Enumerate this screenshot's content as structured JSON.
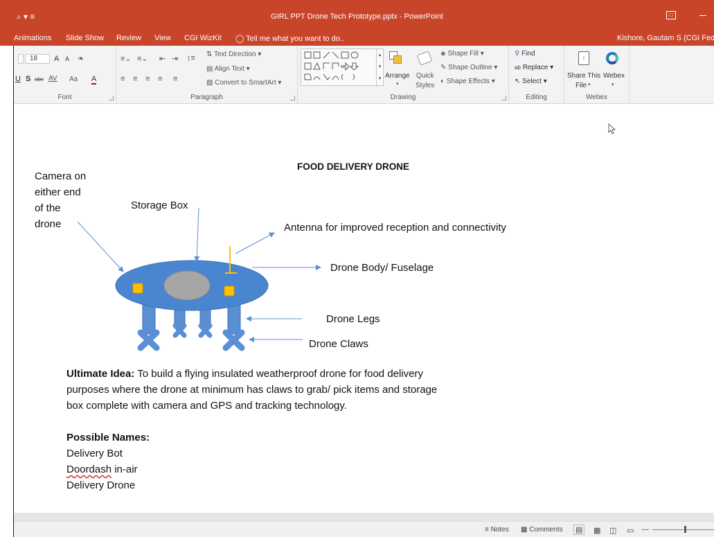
{
  "window": {
    "title": "GIRL PPT Drone Tech Prototype.pptx - PowerPoint",
    "quick_access": "⌕ ▾ ≡"
  },
  "tabs": [
    {
      "label": "Animations"
    },
    {
      "label": "Slide Show"
    },
    {
      "label": "Review"
    },
    {
      "label": "View"
    },
    {
      "label": "CGI WizKit"
    }
  ],
  "tell_me": "Tell me what you want to do..",
  "user": "Kishore, Gautam S (CGI Fed",
  "ribbon": {
    "font": {
      "size": "18",
      "label": "Font",
      "bold": "U",
      "strike": "S",
      "abc": "abc",
      "spacing": "AV",
      "case": "Aa",
      "color": "A",
      "grow": "A",
      "shrink": "A"
    },
    "paragraph": {
      "label": "Paragraph",
      "text_direction": "Text Direction",
      "align_text": "Align Text",
      "smartart": "Convert to SmartArt"
    },
    "drawing": {
      "label": "Drawing",
      "arrange": "Arrange",
      "quick": "Quick",
      "styles": "Styles",
      "shape_fill": "Shape Fill",
      "shape_outline": "Shape Outline",
      "shape_effects": "Shape Effects"
    },
    "editing": {
      "label": "Editing",
      "find": "Find",
      "replace": "Replace",
      "select": "Select"
    },
    "webex": {
      "label": "Webex",
      "share_line1": "Share This",
      "share_line2": "File",
      "webex_label": "Webex"
    }
  },
  "slide": {
    "title": "FOOD DELIVERY DRONE",
    "camera_label": [
      "Camera on",
      "either end",
      "of the",
      "drone"
    ],
    "storage_label": "Storage Box",
    "antenna_label": "Antenna for improved reception and connectivity",
    "body_label": "Drone Body/ Fuselage",
    "legs_label": "Drone Legs",
    "claws_label": "Drone Claws",
    "idea_bold": "Ultimate Idea:",
    "idea_line1": " To build a flying insulated weatherproof drone for food delivery",
    "idea_line2": "purposes where the drone at minimum has claws to grab/ pick items and storage",
    "idea_line3": "box complete with camera and GPS and tracking technology.",
    "names_heading": "Possible Names:",
    "names": [
      "Delivery Bot",
      "Doordash",
      " in-air",
      "Delivery Drone"
    ]
  },
  "status": {
    "notes": "Notes",
    "comments": "Comments"
  },
  "colors": {
    "accent": "#c9452a",
    "drone_body": "#4a86d0",
    "storage": "#a6a6a6",
    "camera": "#ffc000",
    "arrow": "#5b8fd4"
  }
}
